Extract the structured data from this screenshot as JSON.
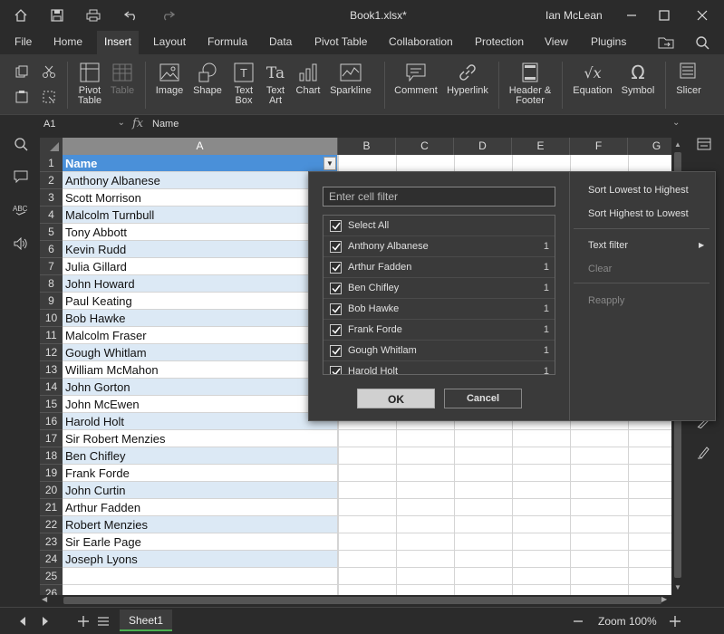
{
  "window": {
    "title": "Book1.xlsx*",
    "user": "Ian McLean"
  },
  "menu": {
    "tabs": [
      "File",
      "Home",
      "Insert",
      "Layout",
      "Formula",
      "Data",
      "Pivot Table",
      "Collaboration",
      "Protection",
      "View",
      "Plugins"
    ],
    "active": "Insert"
  },
  "ribbon": {
    "pivot_table": "Pivot\nTable",
    "table": "Table",
    "image": "Image",
    "shape": "Shape",
    "text_box": "Text\nBox",
    "text_art": "Text\nArt",
    "chart": "Chart",
    "sparkline": "Sparkline",
    "comment": "Comment",
    "hyperlink": "Hyperlink",
    "header_footer": "Header &\nFooter",
    "equation": "Equation",
    "symbol": "Symbol",
    "slicer": "Slicer"
  },
  "formula_bar": {
    "cell_ref": "A1",
    "fx": "fx",
    "value": "Name"
  },
  "grid": {
    "columns": [
      "A",
      "B",
      "C",
      "D",
      "E",
      "F",
      "G"
    ],
    "rows": [
      "1",
      "2",
      "3",
      "4",
      "5",
      "6",
      "7",
      "8",
      "9",
      "10",
      "11",
      "12",
      "13",
      "14",
      "15",
      "16",
      "17",
      "18",
      "19",
      "20",
      "21",
      "22",
      "23",
      "24",
      "25",
      "26"
    ],
    "column_a": [
      "Name",
      "Anthony Albanese",
      "Scott Morrison",
      "Malcolm Turnbull",
      "Tony Abbott",
      "Kevin Rudd",
      "Julia Gillard",
      "John Howard",
      "Paul Keating",
      "Bob Hawke",
      "Malcolm Fraser",
      "Gough Whitlam",
      "William McMahon",
      "John Gorton",
      "John McEwen",
      "Harold Holt",
      "Sir Robert Menzies",
      "Ben Chifley",
      "Frank Forde",
      "John Curtin",
      "Arthur Fadden",
      "Robert Menzies",
      "Sir Earle Page",
      "Joseph Lyons",
      "",
      ""
    ]
  },
  "filter_popup": {
    "search_placeholder": "Enter cell filter",
    "items": [
      {
        "label": "Select All",
        "count": ""
      },
      {
        "label": "Anthony Albanese",
        "count": "1"
      },
      {
        "label": "Arthur Fadden",
        "count": "1"
      },
      {
        "label": "Ben Chifley",
        "count": "1"
      },
      {
        "label": "Bob Hawke",
        "count": "1"
      },
      {
        "label": "Frank Forde",
        "count": "1"
      },
      {
        "label": "Gough Whitlam",
        "count": "1"
      },
      {
        "label": "Harold Holt",
        "count": "1"
      }
    ],
    "ok": "OK",
    "cancel": "Cancel",
    "sort_asc": "Sort Lowest to Highest",
    "sort_desc": "Sort Highest to Lowest",
    "text_filter": "Text filter",
    "clear": "Clear",
    "reapply": "Reapply"
  },
  "status": {
    "sheet_tab": "Sheet1",
    "zoom": "Zoom 100%"
  },
  "colors": {
    "header_fill": "#4a90d9",
    "band_fill": "#dce9f5",
    "sheet_tab_accent": "#4caf50"
  }
}
